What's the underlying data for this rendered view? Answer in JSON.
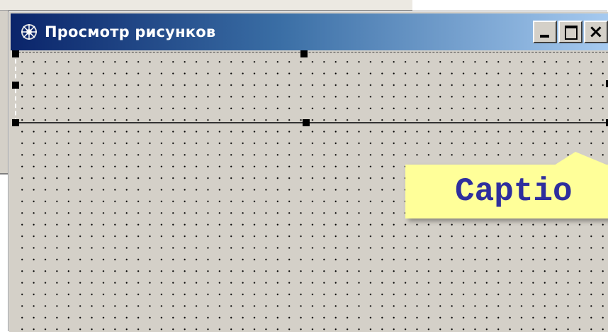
{
  "window": {
    "title": "Просмотр рисунков",
    "buttons": {
      "minimize": "minimize",
      "maximize": "maximize",
      "close": "×"
    }
  },
  "callout": {
    "text": "Captio",
    "background": "#ffff99",
    "text_color": "#2e2e9e"
  },
  "icons": {
    "app": "app-icon",
    "minimize": "minimize-icon",
    "maximize": "maximize-icon",
    "close": "close-icon"
  },
  "colors": {
    "titlebar_start": "#0a246a",
    "titlebar_end": "#a6caf0",
    "form_background": "#d4d0c8"
  }
}
